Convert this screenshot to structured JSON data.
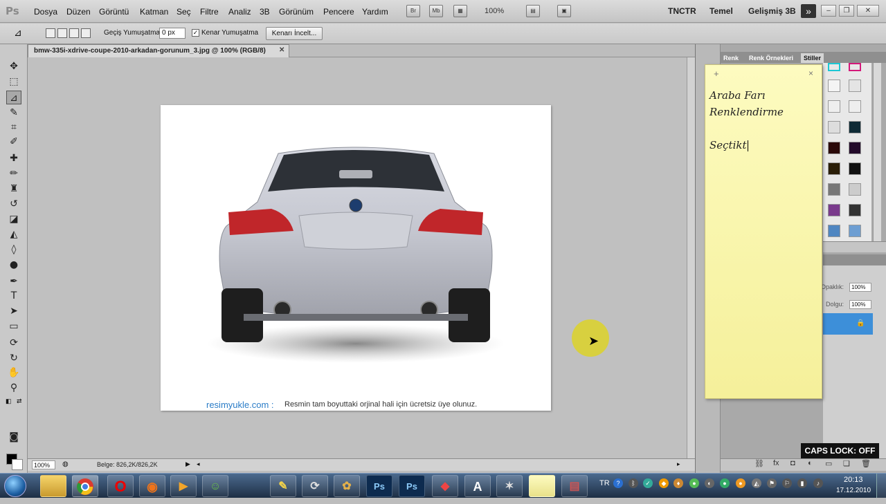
{
  "app": {
    "logo": "Ps"
  },
  "menu": {
    "items": [
      "Dosya",
      "Düzen",
      "Görüntü",
      "Katman",
      "Seç",
      "Filtre",
      "Analiz",
      "3B",
      "Görünüm",
      "Pencere",
      "Yardım"
    ],
    "icons": [
      "Br",
      "Mb"
    ],
    "zoom": "100%"
  },
  "workspaces": [
    "TNCTR",
    "Temel",
    "Gelişmiş 3B"
  ],
  "options_bar": {
    "feather_label": "Geçiş Yumuşatma:",
    "feather_value": "0 px",
    "antialias_checked": true,
    "antialias_label": "Kenar Yumuşatma",
    "refine_edge_label": "Kenarı İncelt..."
  },
  "document": {
    "tab_title": "bmw-335i-xdrive-coupe-2010-arkadan-gorunum_3.jpg @ 100% (RGB/8)",
    "watermark_brand": "resimyukle.com :",
    "watermark_text": "Resmin tam boyuttaki orjinal hali için ücretsiz üye olunuz."
  },
  "status": {
    "zoom": "100%",
    "doc_size": "Belge: 826,2K/826,2K"
  },
  "panels": {
    "tabs": [
      "Renk",
      "Renk Örnekleri",
      "Stiller"
    ],
    "active_tab": "Stiller",
    "opacity_label": "Opaklık:",
    "opacity_value": "100%",
    "fill_label": "Dolgu:",
    "fill_value": "100%"
  },
  "sticky_note": {
    "lines": [
      "Araba Farı",
      "Renklendirme",
      "",
      "Seçtikt"
    ]
  },
  "caps_lock": "CAPS LOCK: OFF",
  "taskbar": {
    "apps": [
      "folder",
      "chrome",
      "opera",
      "firefox",
      "media-player",
      "messenger",
      "pen",
      "app",
      "paint",
      "Ps",
      "Ps",
      "app",
      "avast",
      "counter-strike",
      "notes",
      "winrar"
    ],
    "lang": "TR",
    "time": "20:13",
    "date": "17.12.2010"
  },
  "colors": {
    "accent_layer": "#3d8fd9",
    "sticky_bg": "#fdfbc0",
    "cursor_highlight": "#dcd228",
    "watermark_brand": "#2a7cc7"
  }
}
